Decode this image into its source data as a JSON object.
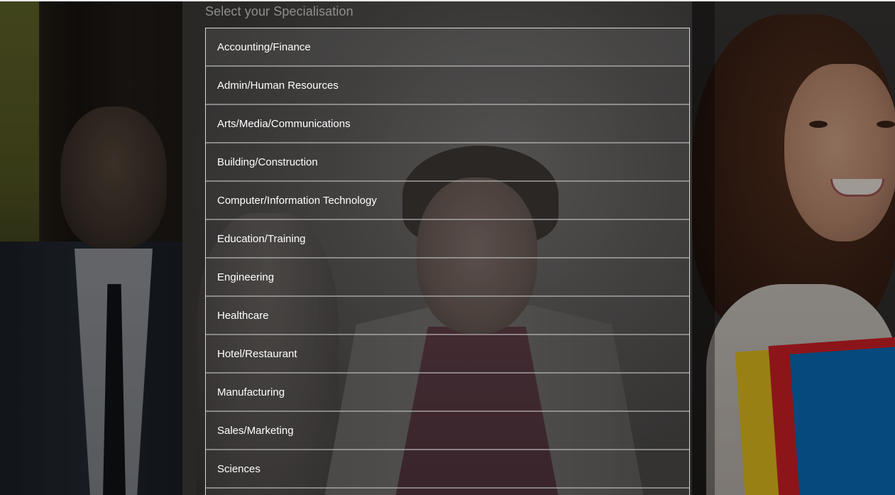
{
  "page": {
    "heading": "Select your Specialisation"
  },
  "specialisations": [
    {
      "label": "Accounting/Finance"
    },
    {
      "label": "Admin/Human Resources"
    },
    {
      "label": "Arts/Media/Communications"
    },
    {
      "label": "Building/Construction"
    },
    {
      "label": "Computer/Information Technology"
    },
    {
      "label": "Education/Training"
    },
    {
      "label": "Engineering"
    },
    {
      "label": "Healthcare"
    },
    {
      "label": "Hotel/Restaurant"
    },
    {
      "label": "Manufacturing"
    },
    {
      "label": "Sales/Marketing"
    },
    {
      "label": "Sciences"
    }
  ],
  "colors": {
    "heading_text": "#8f8f8f",
    "item_text": "#ffffff",
    "list_border": "#d8d8d8"
  }
}
